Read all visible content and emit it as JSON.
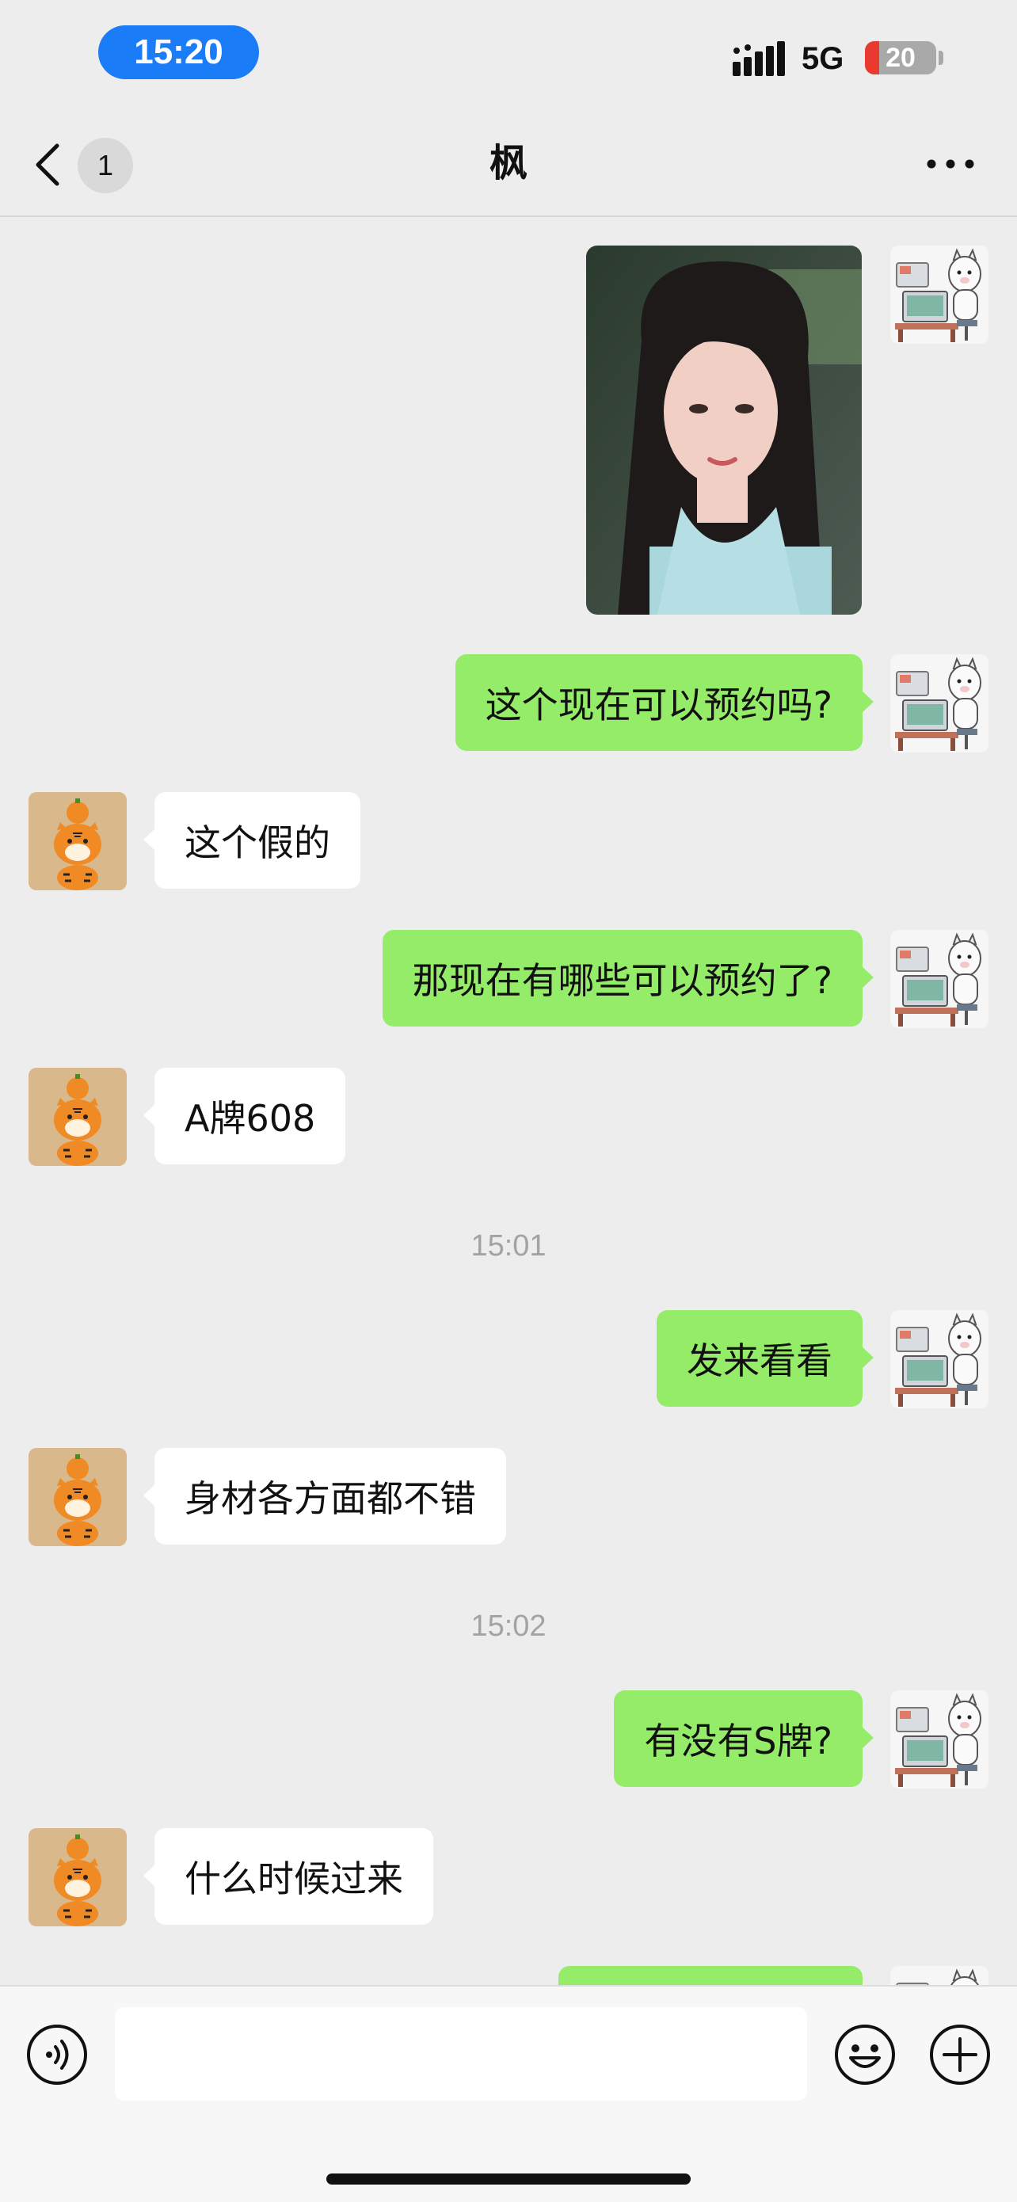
{
  "status_bar": {
    "time": "15:20",
    "network": "5G",
    "battery_level": "20",
    "icons": [
      "signal-icon",
      "battery-icon"
    ]
  },
  "nav": {
    "unread_count": "1",
    "title": "枫",
    "icons": [
      "chevron-left-icon",
      "more-icon"
    ]
  },
  "chat": {
    "timestamps": [
      "15:01",
      "15:02"
    ],
    "messages": [
      {
        "side": "out",
        "type": "image"
      },
      {
        "side": "out",
        "type": "text",
        "text": "这个现在可以预约吗?"
      },
      {
        "side": "in",
        "type": "text",
        "text": "这个假的"
      },
      {
        "side": "out",
        "type": "text",
        "text": "那现在有哪些可以预约了?"
      },
      {
        "side": "in",
        "type": "text",
        "text": "A牌608"
      },
      {
        "side": "out",
        "type": "text",
        "text": "发来看看"
      },
      {
        "side": "in",
        "type": "text",
        "text": "身材各方面都不错"
      },
      {
        "side": "out",
        "type": "text",
        "text": "有没有S牌?"
      },
      {
        "side": "in",
        "type": "text",
        "text": "什么时候过来"
      },
      {
        "side": "out",
        "type": "text",
        "text": ""
      }
    ],
    "avatar_self": "alpaca-at-computer-avatar",
    "avatar_contact": "tiger-with-orange-avatar",
    "colors": {
      "outgoing_bubble": "#95ec69",
      "incoming_bubble": "#ffffff",
      "background": "#ededed"
    }
  },
  "input_bar": {
    "value": "",
    "icons": [
      "voice-icon",
      "emoji-icon",
      "plus-icon"
    ]
  }
}
